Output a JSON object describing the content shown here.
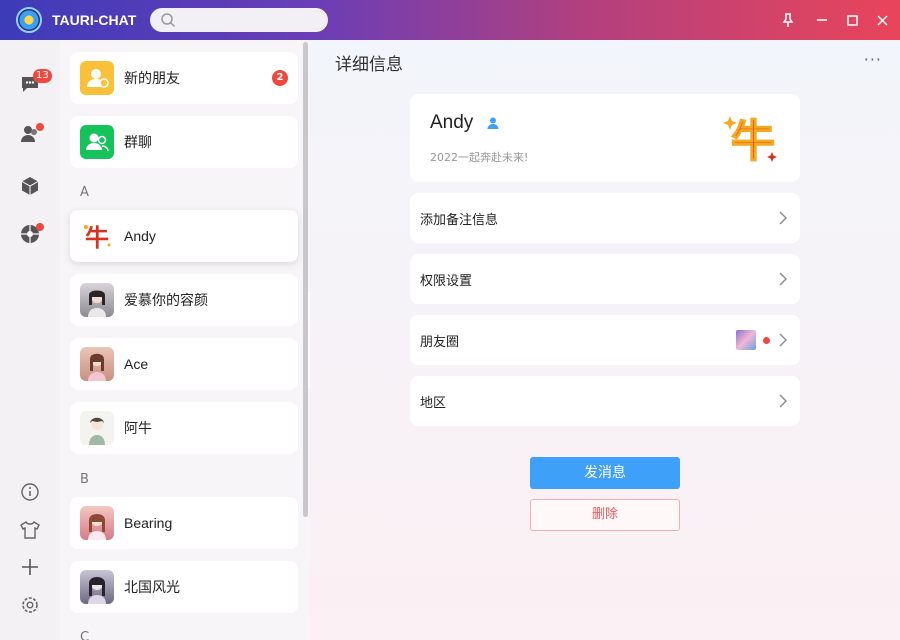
{
  "app": {
    "title": "TAURI-CHAT"
  },
  "search": {
    "placeholder": ""
  },
  "rail": {
    "chat_badge": "13",
    "items": [
      "chat-icon",
      "contacts-icon",
      "cube-icon",
      "moments-icon",
      "info-icon",
      "shirt-icon",
      "plus-icon",
      "settings-icon"
    ]
  },
  "contacts": {
    "new_friends": {
      "label": "新的朋友",
      "badge": "2"
    },
    "group_chat": {
      "label": "群聊"
    },
    "sections": [
      {
        "letter": "A",
        "items": [
          "Andy",
          "爱慕你的容颜",
          "Ace",
          "阿牛"
        ]
      },
      {
        "letter": "B",
        "items": [
          "Bearing",
          "北国风光"
        ]
      },
      {
        "letter": "C",
        "items": []
      }
    ],
    "selected": "Andy"
  },
  "detail": {
    "title": "详细信息",
    "more": "···",
    "name": "Andy",
    "signature": "2022一起奔赴未来!",
    "rows": [
      "添加备注信息",
      "权限设置",
      "朋友圈",
      "地区"
    ],
    "send_label": "发消息",
    "delete_label": "删除"
  },
  "colors": {
    "accent": "#3ea0f8",
    "danger": "#f0483e",
    "new_friend_icon": "#f9c13a",
    "group_icon": "#16c25a"
  }
}
